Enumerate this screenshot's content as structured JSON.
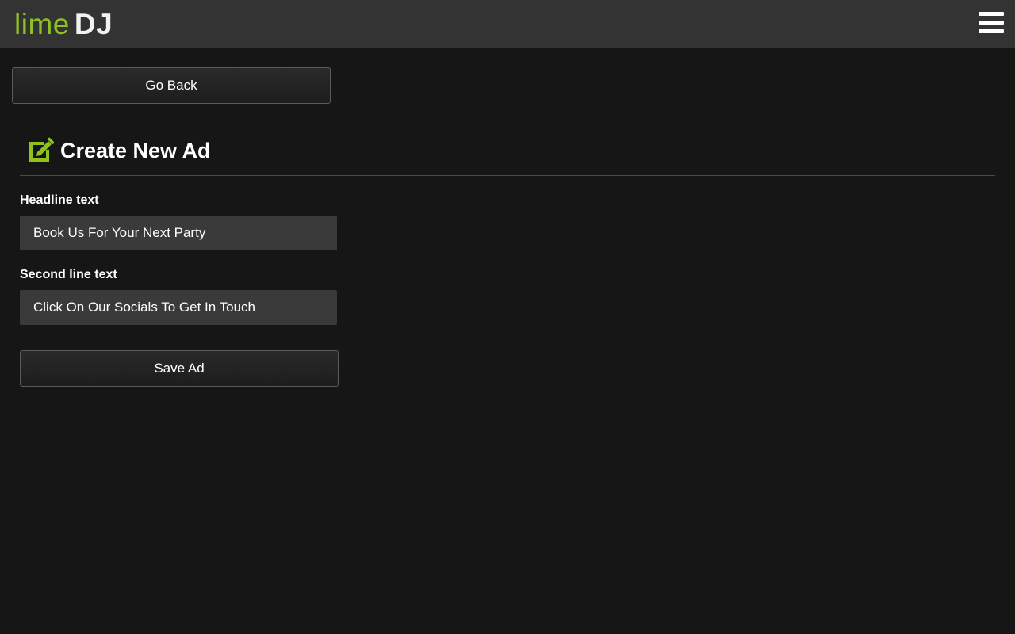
{
  "header": {
    "logo_lime": "lime",
    "logo_dj": "DJ",
    "accent_color": "#8dc21f"
  },
  "nav": {
    "go_back_label": "Go Back",
    "menu_icon": "hamburger-menu-icon"
  },
  "form": {
    "title": "Create New Ad",
    "title_icon": "edit-icon",
    "headline_label": "Headline text",
    "headline_value": "Book Us For Your Next Party",
    "second_line_label": "Second line text",
    "second_line_value": "Click On Our Socials To Get In Touch",
    "save_label": "Save Ad"
  }
}
